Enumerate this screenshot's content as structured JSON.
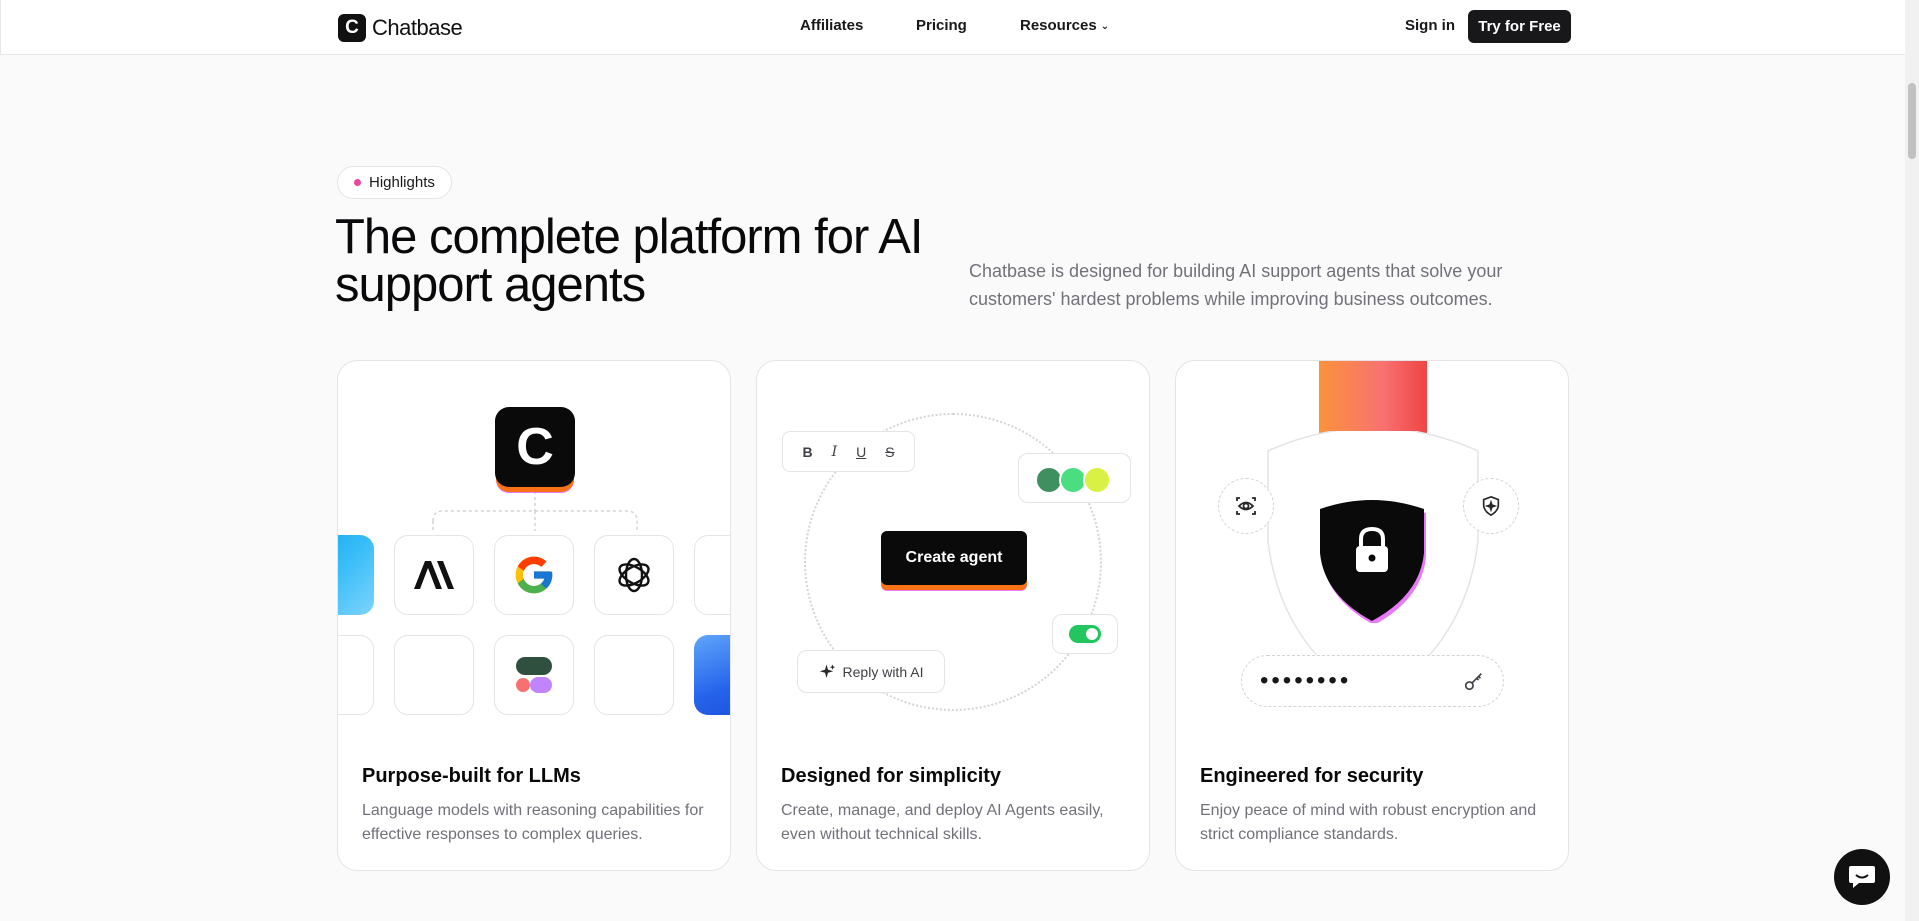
{
  "header": {
    "brand": "Chatbase",
    "nav": {
      "affiliates": "Affiliates",
      "pricing": "Pricing",
      "resources": "Resources"
    },
    "sign_in": "Sign in",
    "try_free": "Try for Free"
  },
  "hero": {
    "badge": "Highlights",
    "title": "The complete platform for AI support agents",
    "description": "Chatbase is designed for building AI support agents that solve your customers' hardest problems while improving business outcomes."
  },
  "cards": [
    {
      "logo_letter": "C",
      "title": "Purpose-built for LLMs",
      "description": "Language models with reasoning capabilities for effective responses to complex queries.",
      "icons": [
        "anthropic-icon",
        "google-icon",
        "openai-icon",
        "figma-like-icon"
      ]
    },
    {
      "toolbar": [
        "B",
        "I",
        "U",
        "S"
      ],
      "button": "Create agent",
      "reply": "Reply with AI",
      "title": "Designed for simplicity",
      "description": "Create, manage, and deploy AI Agents easily, even without technical skills."
    },
    {
      "title": "Engineered for security",
      "description": "Enjoy peace of mind with robust encryption and strict compliance standards.",
      "password_mask": "••••••••"
    }
  ],
  "colors": {
    "accent_orange": "#f97316",
    "accent_pink": "#e879f9",
    "toggle_green": "#22c55e"
  }
}
